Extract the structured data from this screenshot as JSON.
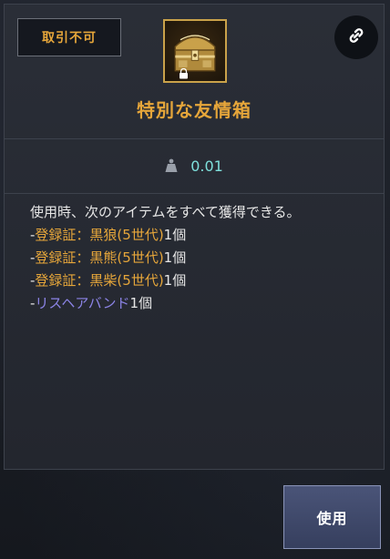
{
  "tooltip": {
    "untradeable_badge": "取引不可",
    "item_name": "特別な友情箱",
    "item_icon": "treasure-chest-icon",
    "lock_icon": "lock-icon",
    "link_icon": "link-icon",
    "weight_icon": "weight-icon",
    "weight_value": "0.01",
    "description_intro": "使用時、次のアイテムをすべて獲得できる。",
    "contents": [
      {
        "dash": "-",
        "name": "登録証：黒狼(5世代)",
        "count": "1個",
        "color": "#e6a63a"
      },
      {
        "dash": "-",
        "name": "登録証：黒熊(5世代)",
        "count": "1個",
        "color": "#e6a63a"
      },
      {
        "dash": "-",
        "name": "登録証：黒柴(5世代)",
        "count": "1個",
        "color": "#e6a63a"
      },
      {
        "dash": "-",
        "name": "リスヘアバンド",
        "count": "1個",
        "color": "#8c84e6"
      }
    ],
    "use_button_label": "使用"
  },
  "colors": {
    "accent_gold": "#e6a63a",
    "weight_teal": "#7fe0dc",
    "rare_purple": "#8c84e6",
    "panel_bg": "#262a32"
  }
}
